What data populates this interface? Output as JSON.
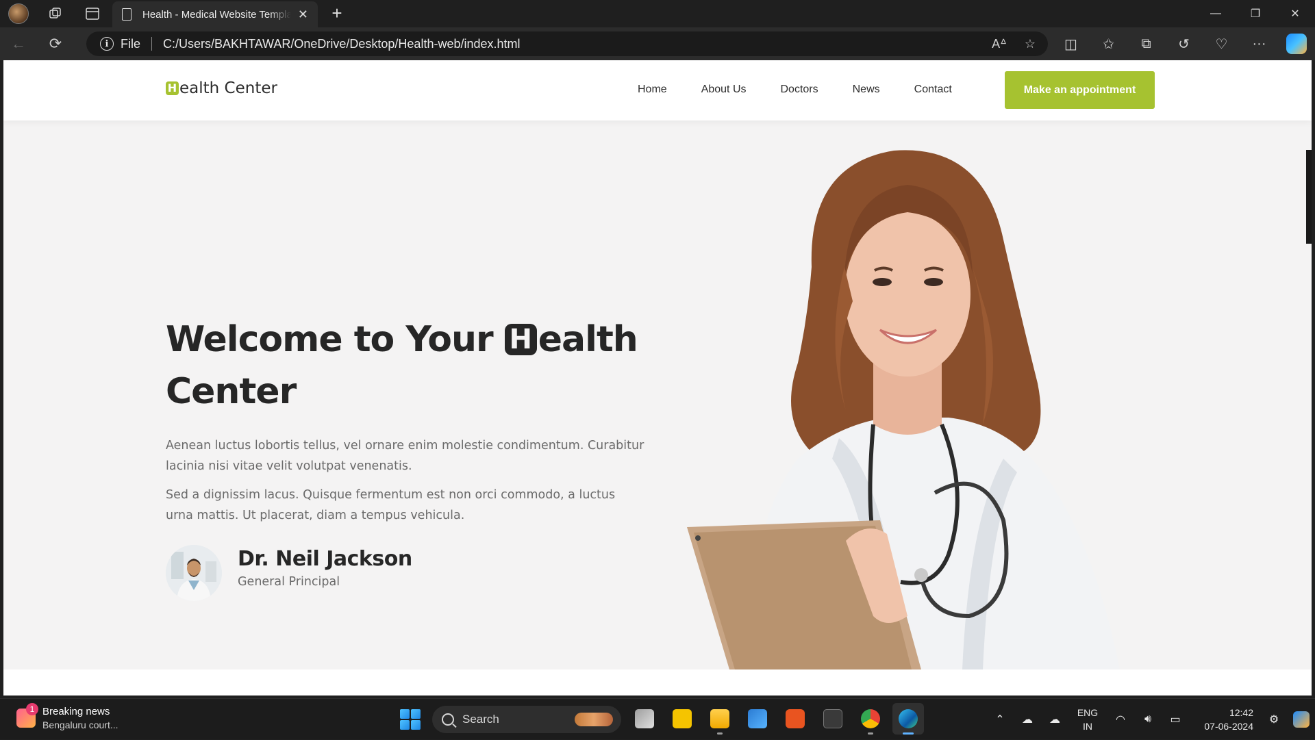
{
  "browser": {
    "tab_title": "Health - Medical Website Template",
    "address": "C:/Users/BAKHTAWAR/OneDrive/Desktop/Health-web/index.html",
    "scheme_label": "File"
  },
  "site": {
    "logo_initial": "H",
    "logo_rest": "ealth Center",
    "nav": [
      "Home",
      "About Us",
      "Doctors",
      "News",
      "Contact"
    ],
    "cta_label": "Make an appointment"
  },
  "hero": {
    "title_before": "Welcome to Your ",
    "title_initial": "H",
    "title_after": "ealth Center",
    "paragraph_1": "Aenean luctus lobortis tellus, vel ornare enim molestie condimentum. Curabitur lacinia nisi vitae velit volutpat venenatis.",
    "paragraph_2": "Sed a dignissim lacus. Quisque fermentum est non orci commodo, a luctus urna mattis. Ut placerat, diam a tempus vehicula.",
    "doctor_name": "Dr. Neil Jackson",
    "doctor_role": "General Principal"
  },
  "taskbar": {
    "news_badge": "1",
    "news_title": "Breaking news",
    "news_subtitle": "Bengaluru court...",
    "search_label": "Search",
    "lang_line1": "ENG",
    "lang_line2": "IN",
    "time": "12:42",
    "date": "07-06-2024"
  },
  "colors": {
    "accent": "#a6c230",
    "hero_bg": "#f4f3f3",
    "heading": "#262626"
  }
}
